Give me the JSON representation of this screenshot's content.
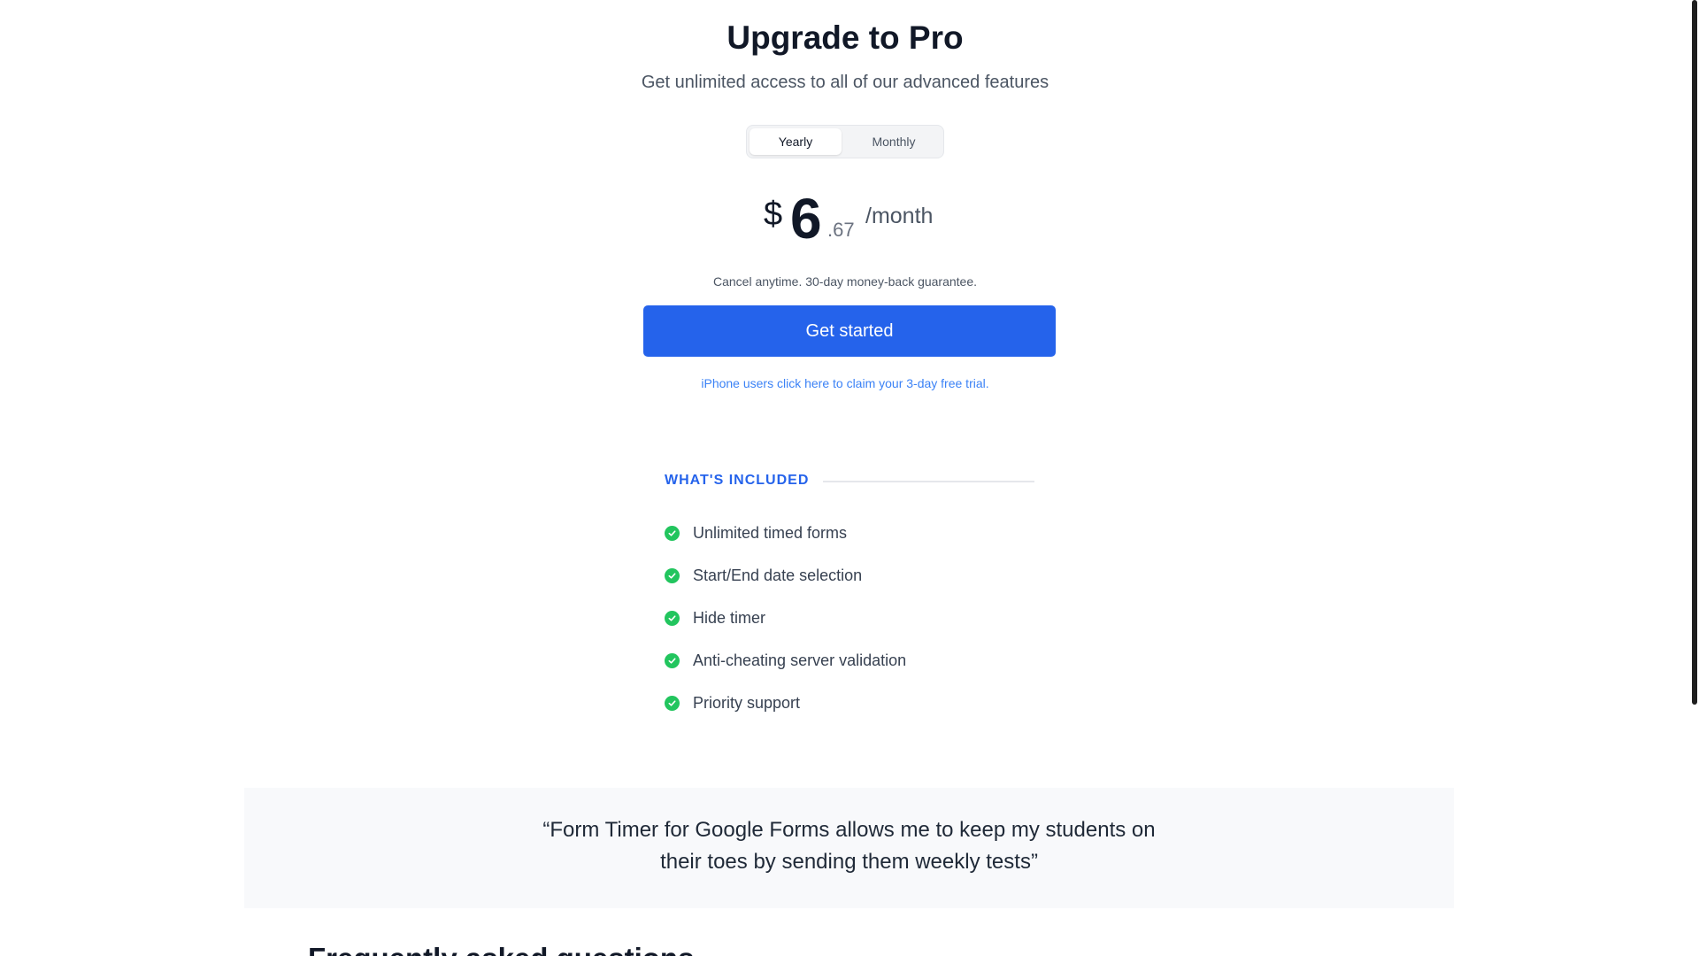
{
  "header": {
    "title": "Upgrade to Pro",
    "subtitle": "Get unlimited access to all of our advanced features"
  },
  "billing_toggle": {
    "options": [
      "Yearly",
      "Monthly"
    ],
    "selected": "Yearly"
  },
  "price": {
    "currency": "$",
    "whole": "6",
    "cents": ".67",
    "period": "/month"
  },
  "guarantee_text": "Cancel anytime. 30-day money-back guarantee.",
  "cta_label": "Get started",
  "trial_link_text": "iPhone users click here to claim your 3-day free trial.",
  "included": {
    "heading": "WHAT'S INCLUDED",
    "features": [
      "Unlimited timed forms",
      "Start/End date selection",
      "Hide timer",
      "Anti-cheating server validation",
      "Priority support"
    ]
  },
  "testimonial": {
    "line1": "“Form Timer for Google Forms allows me to keep my students on",
    "line2": "their toes by sending them weekly tests”"
  },
  "faq": {
    "heading": "Frequently asked questions"
  },
  "colors": {
    "accent": "#2563eb",
    "check": "#22c55e",
    "testimonial_bg": "#f8f9fb"
  }
}
